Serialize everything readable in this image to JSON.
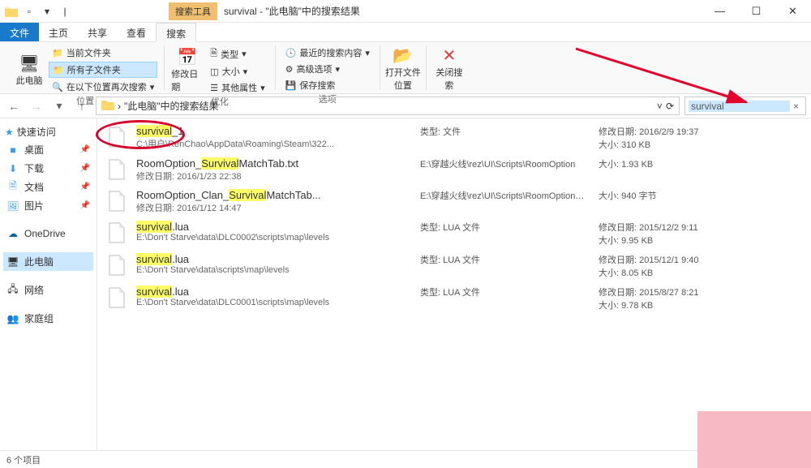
{
  "window": {
    "searchToolsLabel": "搜索工具",
    "title": "survival - \"此电脑\"中的搜索结果",
    "min": "—",
    "max": "☐",
    "close": "✕"
  },
  "tabs": {
    "file": "文件",
    "home": "主页",
    "share": "共享",
    "view": "查看",
    "search": "搜索"
  },
  "ribbon": {
    "thisPc": "此电脑",
    "currentFolder": "当前文件夹",
    "allSubfolders": "所有子文件夹",
    "searchAgainIn": "在以下位置再次搜索",
    "groupLocation": "位置",
    "modifyDate": "修改日期",
    "type": "类型",
    "size": "大小",
    "otherProps": "其他属性",
    "groupRefine": "优化",
    "recentSearches": "最近的搜索内容",
    "advancedOptions": "高级选项",
    "saveSearch": "保存搜索",
    "groupOptions": "选项",
    "openFileLocation": "打开文件位置",
    "closeSearch": "关闭搜索"
  },
  "address": {
    "path": "\"此电脑\"中的搜索结果",
    "searchValue": "survival",
    "refresh": "⟳"
  },
  "sidebar": {
    "quickAccess": "快速访问",
    "desktop": "桌面",
    "downloads": "下载",
    "documents": "文档",
    "pictures": "图片",
    "onedrive": "OneDrive",
    "thisPc": "此电脑",
    "network": "网络",
    "homegroup": "家庭组"
  },
  "labels": {
    "modDate": "修改日期:",
    "size": "大小:",
    "type": "类型:"
  },
  "results": [
    {
      "title_pre": "",
      "title_hl": "survival",
      "title_post": "_1",
      "path": "C:\\用户\\RenChao\\AppData\\Roaming\\Steam\\322...",
      "typeText": "类型: 文件",
      "modDate": "2016/2/9 19:37",
      "size": "310 KB"
    },
    {
      "title_pre": "RoomOption_",
      "title_hl": "Survival",
      "title_post": "MatchTab.txt",
      "path": "修改日期: 2016/1/23 22:38",
      "typeText": "E:\\穿越火线\\rez\\UI\\Scripts\\RoomOption",
      "modDate": "",
      "size": "1.93 KB"
    },
    {
      "title_pre": "RoomOption_Clan_",
      "title_hl": "Survival",
      "title_post": "MatchTab...",
      "path": "修改日期: 2016/1/12 14:47",
      "typeText": "E:\\穿越火线\\rez\\UI\\Scripts\\RoomOptionClan",
      "modDate": "",
      "size": "940 字节"
    },
    {
      "title_pre": "",
      "title_hl": "survival",
      "title_post": ".lua",
      "path": "E:\\Don't Starve\\data\\DLC0002\\scripts\\map\\levels",
      "typeText": "类型: LUA 文件",
      "modDate": "2015/12/2 9:11",
      "size": "9.95 KB"
    },
    {
      "title_pre": "",
      "title_hl": "survival",
      "title_post": ".lua",
      "path": "E:\\Don't Starve\\data\\scripts\\map\\levels",
      "typeText": "类型: LUA 文件",
      "modDate": "2015/12/1 9:40",
      "size": "8.05 KB"
    },
    {
      "title_pre": "",
      "title_hl": "survival",
      "title_post": ".lua",
      "path": "E:\\Don't Starve\\data\\DLC0001\\scripts\\map\\levels",
      "typeText": "类型: LUA 文件",
      "modDate": "2015/8/27 8:21",
      "size": "9.78 KB"
    }
  ],
  "status": {
    "count": "6 个项目"
  }
}
